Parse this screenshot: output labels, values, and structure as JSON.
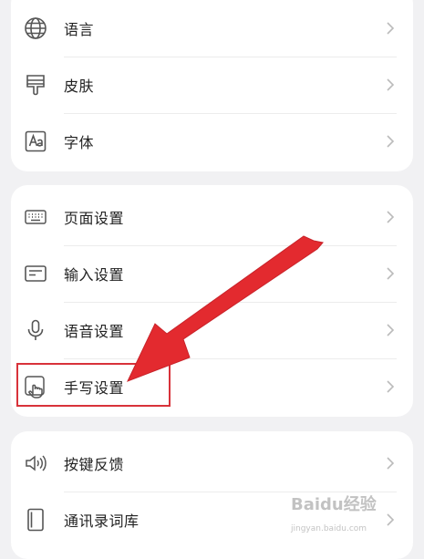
{
  "card_general": {
    "items": [
      {
        "label": "语言",
        "icon": "globe-icon"
      },
      {
        "label": "皮肤",
        "icon": "paint-brush-icon"
      },
      {
        "label": "字体",
        "icon": "font-icon"
      }
    ]
  },
  "card_input": {
    "items": [
      {
        "label": "页面设置",
        "icon": "keyboard-icon"
      },
      {
        "label": "输入设置",
        "icon": "input-box-icon"
      },
      {
        "label": "语音设置",
        "icon": "microphone-icon"
      },
      {
        "label": "手写设置",
        "icon": "handwriting-icon"
      }
    ]
  },
  "card_other": {
    "items": [
      {
        "label": "按键反馈",
        "icon": "speaker-icon"
      },
      {
        "label": "通讯录词库",
        "icon": "phone-book-icon"
      }
    ]
  },
  "annotation": {
    "highlight_color": "#d8323a",
    "arrow_color": "#e32a2f",
    "highlighted_item": "手写设置"
  },
  "watermark": {
    "logo": "Baidu经验",
    "url": "jingyan.baidu.com"
  }
}
